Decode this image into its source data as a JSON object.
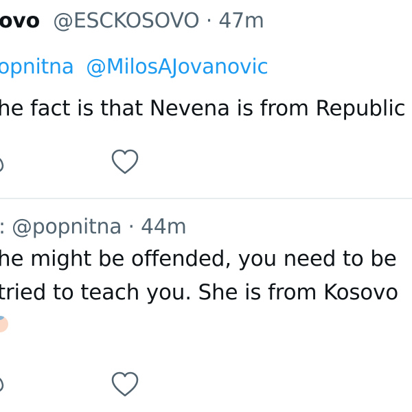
{
  "tweets": [
    {
      "display_name": "ovo",
      "handle": "@ESCKOSOVO",
      "separator": " · ",
      "time": "47m",
      "replying_mentions": [
        "opnitna",
        "@MilosAJovanovic"
      ],
      "text_lines": [
        "he fact is that Nevena is from Republic"
      ],
      "icons": {
        "reply": "reply-icon",
        "like": "heart-icon"
      }
    },
    {
      "display_name": "",
      "handle": ": @popnitna",
      "separator": " · ",
      "time": "44m",
      "text_lines": [
        "he might be offended, you need to be",
        "tried to teach you. She is from Kosovo"
      ],
      "icons": {
        "reply": "reply-icon",
        "like": "heart-icon",
        "emoji": "emoji-face-icon"
      }
    }
  ],
  "colors": {
    "link": "#1d9bf0",
    "secondary_text": "#536471",
    "primary_text": "#0f1419",
    "divider": "#e7ecef"
  }
}
